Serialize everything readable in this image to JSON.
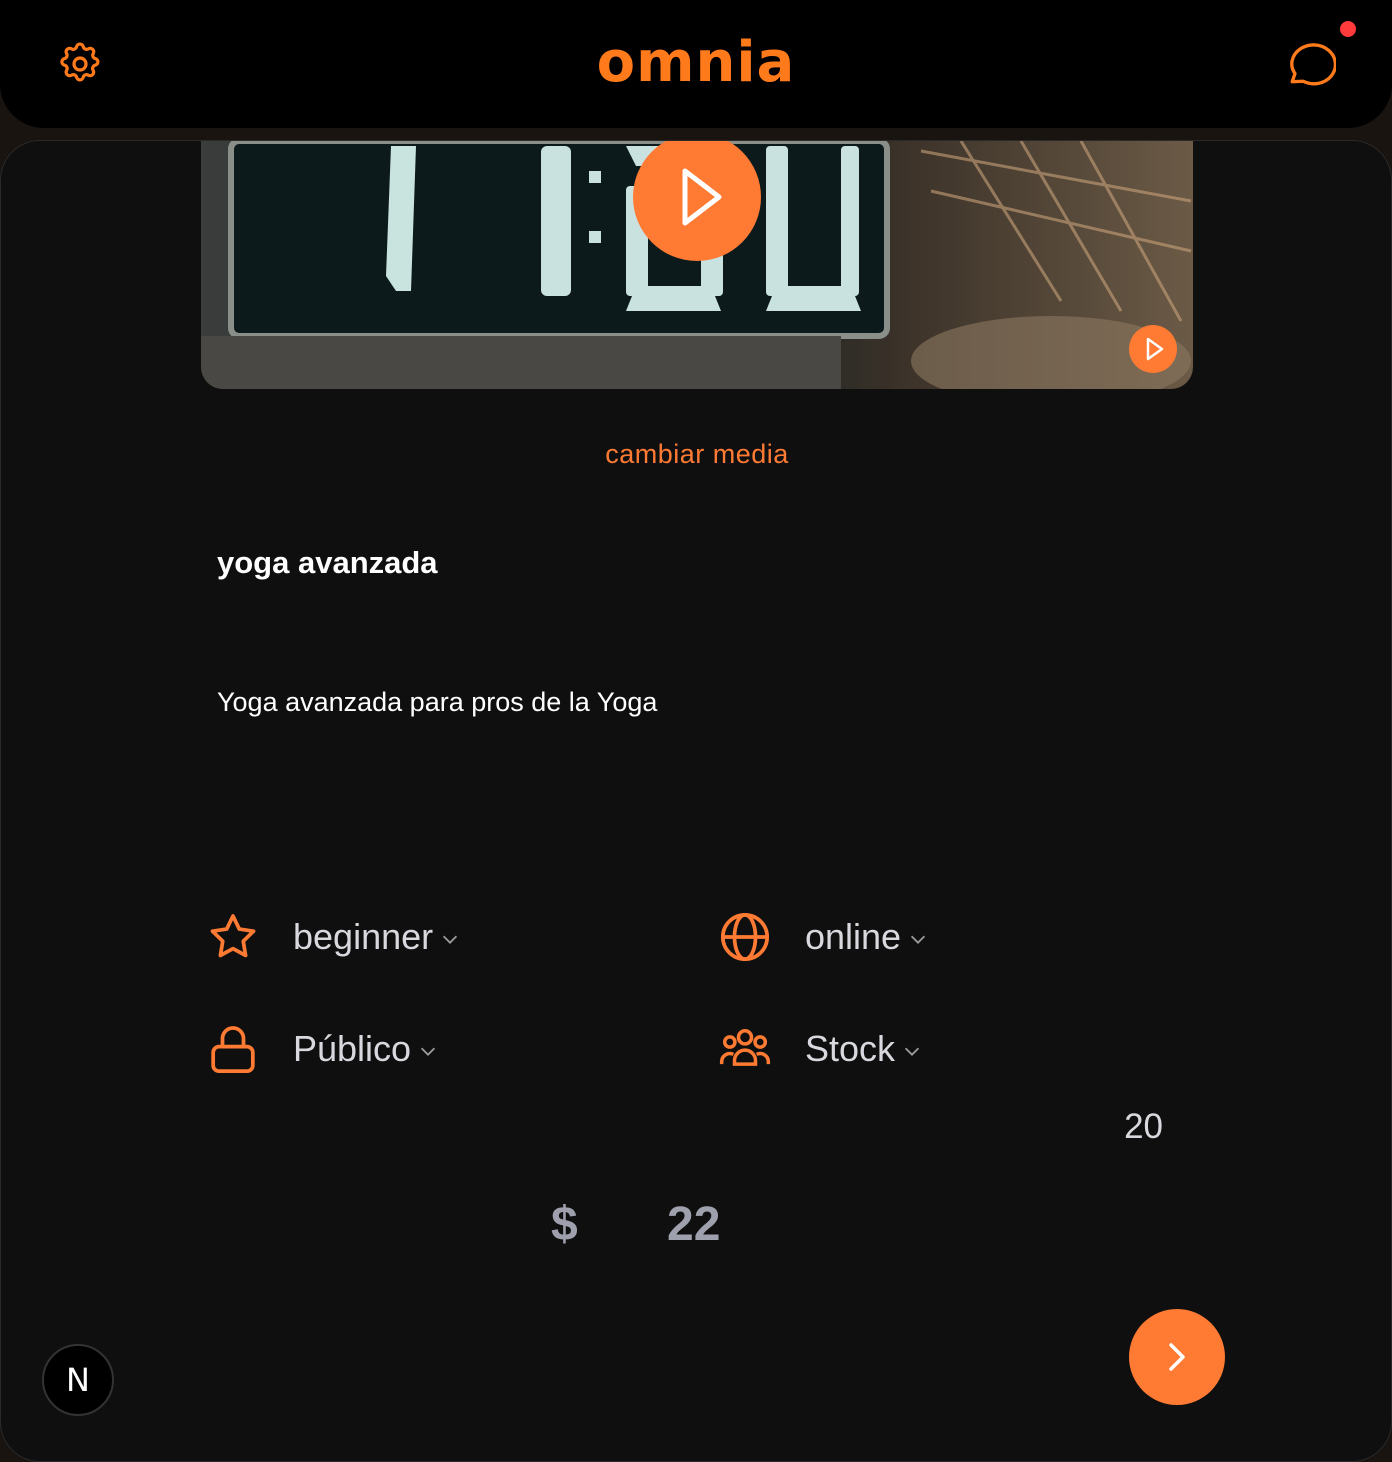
{
  "header": {
    "logo": "omnia",
    "settings_icon": "gear-icon",
    "chat_icon": "chat-bubble-icon",
    "has_notification": true,
    "accent_color": "#ff7a1a",
    "notification_color": "#ff3b3b"
  },
  "media": {
    "play_icon": "play-icon",
    "change_label": "cambiar media"
  },
  "product": {
    "title": "yoga avanzada",
    "description": "Yoga avanzada para pros de la Yoga"
  },
  "options": {
    "level": {
      "icon": "star-icon",
      "value": "beginner"
    },
    "mode": {
      "icon": "globe-icon",
      "value": "online"
    },
    "visibility": {
      "icon": "lock-icon",
      "value": "Público"
    },
    "capacity": {
      "icon": "users-icon",
      "value": "Stock",
      "quantity": "20"
    }
  },
  "pricing": {
    "currency": "$",
    "amount": "22"
  },
  "actions": {
    "next_icon": "chevron-right-icon"
  },
  "badge": {
    "label": "N"
  }
}
